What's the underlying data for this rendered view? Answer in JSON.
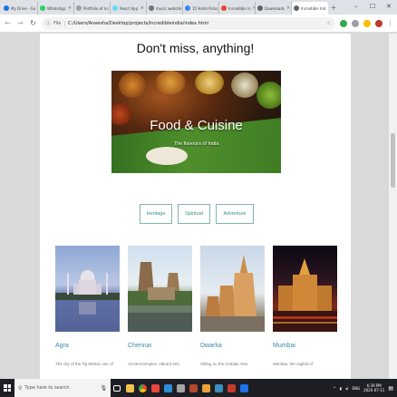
{
  "browser": {
    "tabs": [
      {
        "label": "My Drive - Go",
        "color": "#1a73e8",
        "active": false
      },
      {
        "label": "WhatsApp",
        "color": "#25d366",
        "active": false
      },
      {
        "label": "Portfolio of Ini",
        "color": "#9e9e9e",
        "active": false
      },
      {
        "label": "React App",
        "color": "#61dafb",
        "active": false
      },
      {
        "label": "music website",
        "color": "#757575",
        "active": false
      },
      {
        "label": "15 Hotel Picks",
        "color": "#4285f4",
        "active": false
      },
      {
        "label": "Incredible in",
        "color": "#ea4335",
        "active": false
      },
      {
        "label": "Downloads",
        "color": "#5f6368",
        "active": false
      },
      {
        "label": "Incredible Ind",
        "color": "#5f6368",
        "active": true
      }
    ],
    "address": {
      "prefix": "File",
      "url": "C:/Users/Aneesha/Desktop/projects/Incredibleindia/index.html"
    }
  },
  "page": {
    "heading": "Don't miss, anything!",
    "hero": {
      "title": "Food & Cuisine",
      "subtitle": "The flavours of India"
    },
    "filters": [
      {
        "label": "Heritage"
      },
      {
        "label": "Spiritual"
      },
      {
        "label": "Adventure"
      }
    ],
    "cards": [
      {
        "title": "Agra",
        "desc": "The city of the Taj Mahal, one of"
      },
      {
        "title": "Chennai",
        "desc": "Ancient temples, vibrant arts,"
      },
      {
        "title": "Dwarka",
        "desc": "Sitting on the Arabian Sea"
      },
      {
        "title": "Mumbai",
        "desc": "Mumbai, the capital of"
      }
    ]
  },
  "taskbar": {
    "search_placeholder": "Type here to search",
    "lang": "ENG",
    "time": "6:39 PM",
    "date": "2020-07-11"
  }
}
